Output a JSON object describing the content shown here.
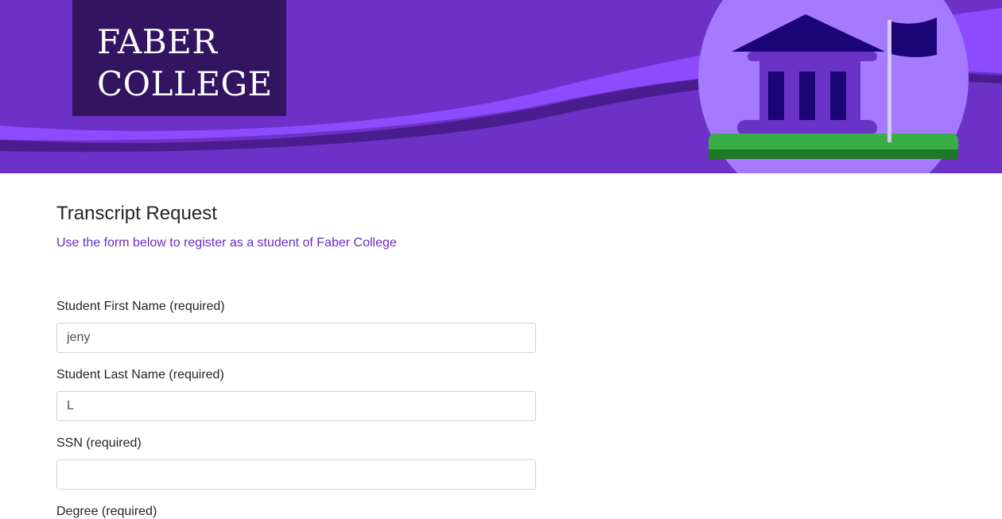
{
  "header": {
    "logo_line1": "FABER",
    "logo_line2": "COLLEGE",
    "colors": {
      "banner_bg": "#6c31c6",
      "wave_light": "#8c4bff",
      "wave_dark": "#4a1d8e",
      "logo_bg": "#321460",
      "circle": "#a57aff",
      "building_dark": "#1b0576",
      "building_mid": "#6a33c8",
      "grass": "#3aae46",
      "flagpole": "#d6c8f5"
    },
    "icons": [
      "building-icon",
      "flag-icon"
    ]
  },
  "form": {
    "title": "Transcript Request",
    "subtitle": "Use the form below to register as a student of Faber College",
    "fields": [
      {
        "label": "Student First Name (required)",
        "value": "jeny",
        "placeholder": ""
      },
      {
        "label": "Student Last Name (required)",
        "value": "L",
        "placeholder": ""
      },
      {
        "label": "SSN (required)",
        "value": "",
        "placeholder": ""
      },
      {
        "label": "Degree (required)"
      }
    ]
  }
}
